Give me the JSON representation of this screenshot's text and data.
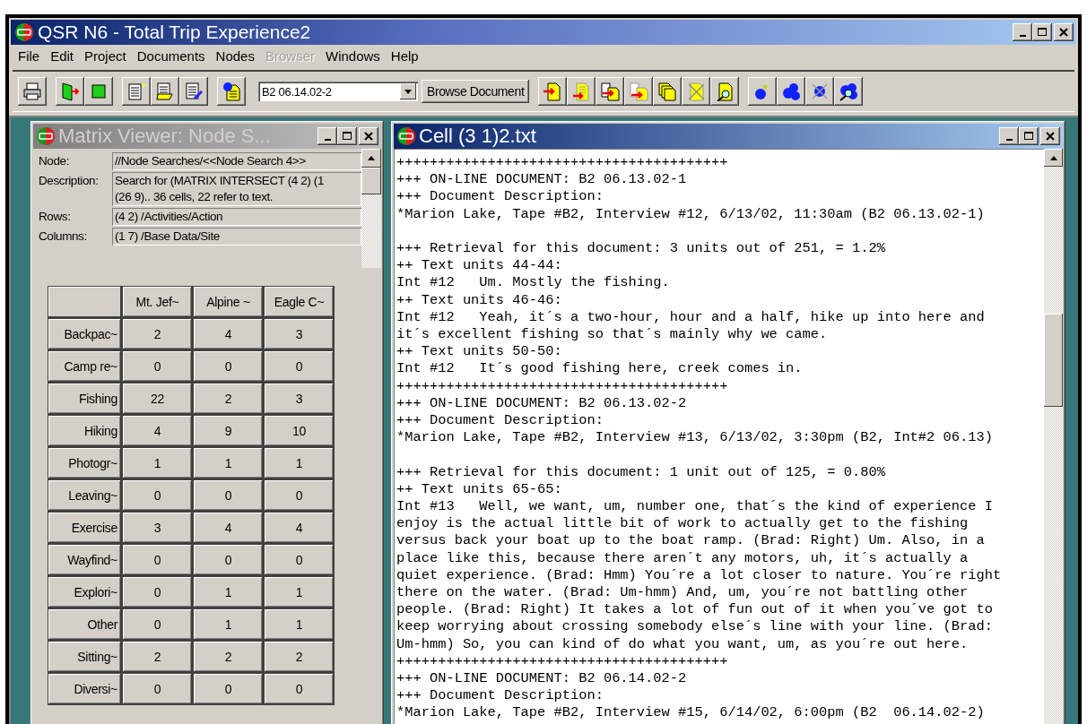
{
  "window": {
    "title": "QSR N6 - Total Trip Experience2"
  },
  "menu": [
    {
      "label": "File",
      "disabled": false
    },
    {
      "label": "Edit",
      "disabled": false
    },
    {
      "label": "Project",
      "disabled": false
    },
    {
      "label": "Documents",
      "disabled": false
    },
    {
      "label": "Nodes",
      "disabled": false
    },
    {
      "label": "Browser",
      "disabled": true
    },
    {
      "label": "Windows",
      "disabled": false
    },
    {
      "label": "Help",
      "disabled": false
    }
  ],
  "toolbar": {
    "document_select": {
      "value": "B2 06.14.02-2"
    },
    "browse_button": "Browse Document"
  },
  "matrix_viewer": {
    "title": "Matrix Viewer: Node S...",
    "fields": [
      {
        "label": "Node:",
        "lines": [
          "//Node Searches/<<Node Search 4>>"
        ]
      },
      {
        "label": "Description:",
        "lines": [
          "Search for (MATRIX INTERSECT (4 2) (1",
          "(26 9)..  36 cells, 22 refer to text."
        ]
      },
      {
        "label": "Rows:",
        "lines": [
          "(4 2) /Activities/Action"
        ]
      },
      {
        "label": "Columns:",
        "lines": [
          "(1 7) /Base Data/Site"
        ]
      }
    ],
    "columns": [
      "Mt. Jef~",
      "Alpine ~",
      "Eagle C~"
    ],
    "rows": [
      {
        "label": "Backpac~",
        "values": [
          "2",
          "4",
          "3"
        ]
      },
      {
        "label": "Camp re~",
        "values": [
          "0",
          "0",
          "0"
        ]
      },
      {
        "label": "Fishing",
        "values": [
          "22",
          "2",
          "3"
        ]
      },
      {
        "label": "Hiking",
        "values": [
          "4",
          "9",
          "10"
        ]
      },
      {
        "label": "Photogr~",
        "values": [
          "1",
          "1",
          "1"
        ]
      },
      {
        "label": "Leaving~",
        "values": [
          "0",
          "0",
          "0"
        ]
      },
      {
        "label": "Exercise",
        "values": [
          "3",
          "4",
          "4"
        ]
      },
      {
        "label": "Wayfind~",
        "values": [
          "0",
          "0",
          "0"
        ]
      },
      {
        "label": "Explori~",
        "values": [
          "0",
          "1",
          "1"
        ]
      },
      {
        "label": "Other",
        "values": [
          "0",
          "1",
          "1"
        ]
      },
      {
        "label": "Sitting~",
        "values": [
          "2",
          "2",
          "2"
        ]
      },
      {
        "label": "Diversi~",
        "values": [
          "0",
          "0",
          "0"
        ]
      }
    ]
  },
  "cell_window": {
    "title": "Cell (3 1)2.txt",
    "blocks": [
      [
        "++++++++++++++++++++++++++++++++++++++++",
        "+++ ON-LINE DOCUMENT: B2 06.13.02-1",
        "+++ Document Description:",
        "*Marion Lake, Tape #B2, Interview #12, 6/13/02, 11:30am (B2 06.13.02-1)"
      ],
      [
        "+++ Retrieval for this document: 3 units out of 251, = 1.2%",
        "++ Text units 44-44:",
        "Int #12   Um. Mostly the fishing.",
        "++ Text units 46-46:",
        "Int #12   Yeah, it´s a two-hour, hour and a half, hike up into here and",
        "it´s excellent fishing so that´s mainly why we came.",
        "++ Text units 50-50:",
        "Int #12   It´s good fishing here, creek comes in.",
        "++++++++++++++++++++++++++++++++++++++++",
        "+++ ON-LINE DOCUMENT: B2 06.13.02-2",
        "+++ Document Description:",
        "*Marion Lake, Tape #B2, Interview #13, 6/13/02, 3:30pm (B2, Int#2 06.13)"
      ],
      [
        "+++ Retrieval for this document: 1 unit out of 125, = 0.80%",
        "++ Text units 65-65:",
        "Int #13   Well, we want, um, number one, that´s the kind of experience I",
        "enjoy is the actual little bit of work to actually get to the fishing",
        "versus back your boat up to the boat ramp. (Brad: Right) Um. Also, in a",
        "place like this, because there aren´t any motors, uh, it´s actually a",
        "quiet experience. (Brad: Hmm) You´re a lot closer to nature. You´re right",
        "there on the water. (Brad: Um-hmm) And, um, you´re not battling other",
        "people. (Brad: Right) It takes a lot of fun out of it when you´ve got to",
        "keep worrying about crossing somebody else´s line with your line. (Brad:",
        "Um-hmm) So, you can kind of do what you want, um, as you´re out here.",
        "++++++++++++++++++++++++++++++++++++++++",
        "+++ ON-LINE DOCUMENT: B2 06.14.02-2",
        "+++ Document Description:",
        "*Marion Lake, Tape #B2, Interview #15, 6/14/02, 6:00pm (B2  06.14.02-2)"
      ]
    ]
  }
}
